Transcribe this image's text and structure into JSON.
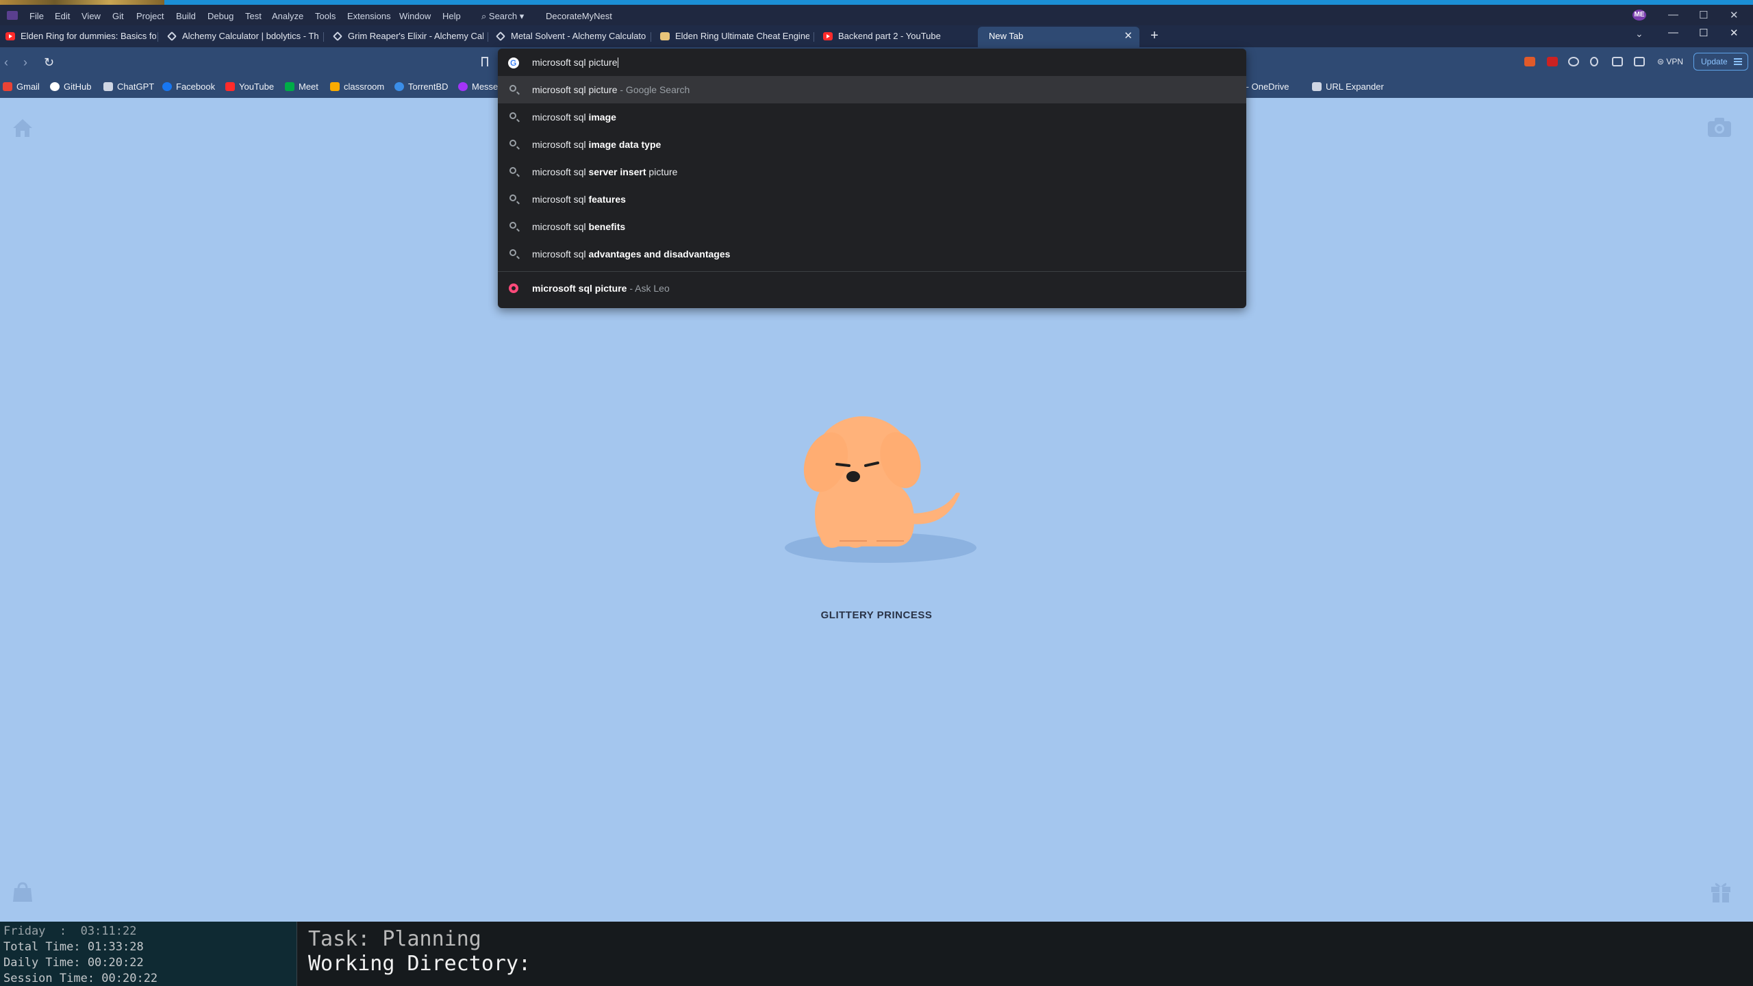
{
  "vs_menu": {
    "items": [
      "File",
      "Edit",
      "View",
      "Git",
      "Project",
      "Build",
      "Debug",
      "Test",
      "Analyze",
      "Tools",
      "Extensions",
      "Window",
      "Help"
    ],
    "search_label": "⌕ Search ▾",
    "solution_name": "DecorateMyNest",
    "avatar_initials": "ME"
  },
  "tabs": [
    {
      "title": "Elden Ring for dummies: Basics for E",
      "icon": "youtube-icon"
    },
    {
      "title": "Alchemy Calculator | bdolytics - The",
      "icon": "bdolytics-icon"
    },
    {
      "title": "Grim Reaper's Elixir - Alchemy Calcu",
      "icon": "bdolytics-icon"
    },
    {
      "title": "Metal Solvent - Alchemy Calculator |",
      "icon": "bdolytics-icon"
    },
    {
      "title": "Elden Ring Ultimate Cheat Engine Ta",
      "icon": "cheat-engine-icon"
    },
    {
      "title": "Backend part 2 - YouTube",
      "icon": "youtube-icon"
    }
  ],
  "active_tab": {
    "title": "New Tab",
    "close": "✕"
  },
  "new_tab_symbol": "+",
  "toolbar": {
    "vpn_label": "VPN",
    "update_label": "Update"
  },
  "bookmarks": [
    {
      "label": "Gmail",
      "color": "#ea4335"
    },
    {
      "label": "GitHub",
      "color": "#ffffff"
    },
    {
      "label": "ChatGPT",
      "color": "#cfd6e4"
    },
    {
      "label": "Facebook",
      "color": "#1877f2"
    },
    {
      "label": "YouTube",
      "color": "#ff2b2b"
    },
    {
      "label": "Meet",
      "color": "#00ac47"
    },
    {
      "label": "classroom",
      "color": "#f9ab00"
    },
    {
      "label": "TorrentBD",
      "color": "#3b8ee8"
    },
    {
      "label": "Messe",
      "color": "#a334fa"
    },
    {
      "label": "me - OneDrive",
      "color": "#0078d4"
    },
    {
      "label": "URL Expander",
      "color": "#cfd6e4"
    }
  ],
  "omnibox": {
    "query": "microsoft sql picture",
    "suggestions": [
      {
        "prefix": "microsoft sql picture",
        "bold": "",
        "suffix": "",
        "note": " - Google Search"
      },
      {
        "prefix": "microsoft sql ",
        "bold": "image",
        "suffix": "",
        "note": ""
      },
      {
        "prefix": "microsoft sql ",
        "bold": "image data type",
        "suffix": "",
        "note": ""
      },
      {
        "prefix": "microsoft sql ",
        "bold": "server insert",
        "suffix": " picture",
        "note": ""
      },
      {
        "prefix": "microsoft sql ",
        "bold": "features",
        "suffix": "",
        "note": ""
      },
      {
        "prefix": "microsoft sql ",
        "bold": "benefits",
        "suffix": "",
        "note": ""
      },
      {
        "prefix": "microsoft sql ",
        "bold": "advantages and disadvantages",
        "suffix": "",
        "note": ""
      }
    ],
    "leo_suggestion": {
      "bold": "microsoft sql picture",
      "note": " - Ask Leo"
    }
  },
  "newtab": {
    "pet_name": "GLITTERY PRINCESS"
  },
  "terminal_left": {
    "day_line": "Friday  :  03:11:22",
    "total_line": "Total Time: 01:33:28",
    "daily_line": "Daily Time: 00:20:22",
    "session_line": "Session Time: 00:20:22"
  },
  "terminal_right": {
    "task_line": "Task: Planning",
    "dir_line": "Working Directory:"
  },
  "colors": {
    "page_background": "#a4c6ee",
    "dropdown_background": "#202124",
    "accent_blue": "#1b8fd6",
    "dog_orange": "#ffb27a"
  }
}
